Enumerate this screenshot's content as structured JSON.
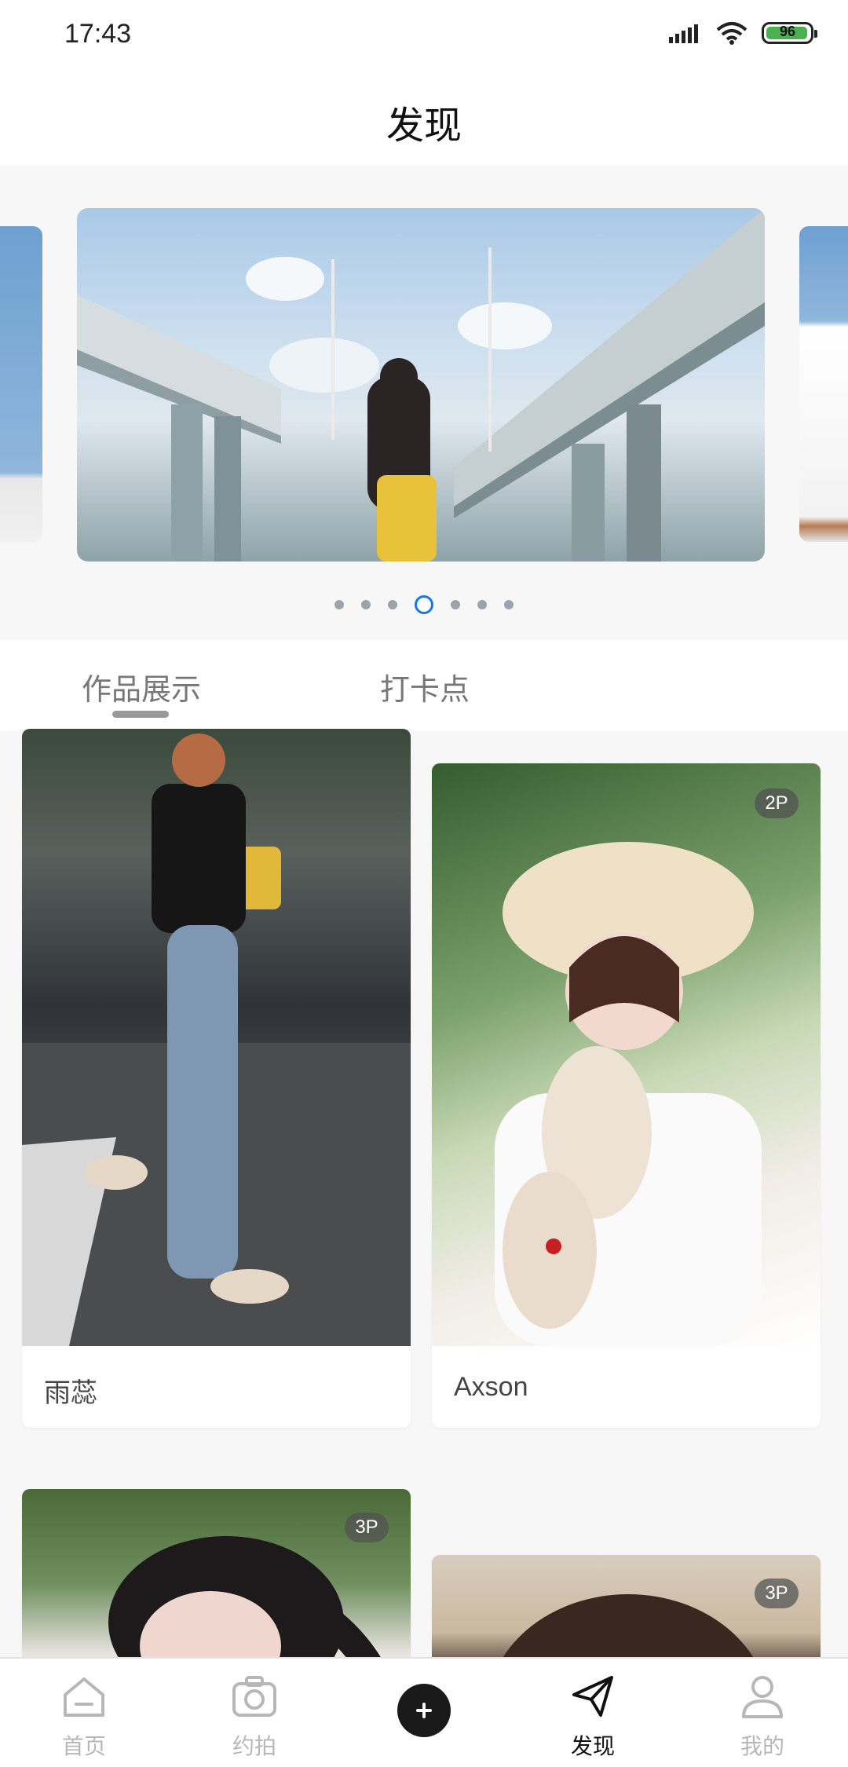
{
  "status": {
    "time": "17:43",
    "battery": "96"
  },
  "header": {
    "title": "发现"
  },
  "carousel": {
    "page_count": 7,
    "active_index": 3
  },
  "tabs": [
    {
      "label": "作品展示",
      "active": true
    },
    {
      "label": "打卡点",
      "active": false
    }
  ],
  "cards": [
    {
      "name": "雨蕊",
      "badge": ""
    },
    {
      "name": "Axson",
      "badge": "2P"
    },
    {
      "name": "",
      "badge": "3P"
    },
    {
      "name": "",
      "badge": "3P"
    }
  ],
  "nav": {
    "items": [
      {
        "label": "首页",
        "icon": "home-icon"
      },
      {
        "label": "约拍",
        "icon": "camera-icon"
      },
      {
        "label": "",
        "icon": "plus-icon"
      },
      {
        "label": "发现",
        "icon": "paper-plane-icon",
        "active": true
      },
      {
        "label": "我的",
        "icon": "person-icon"
      }
    ]
  },
  "colors": {
    "accent": "#1877e8",
    "battery": "#4caf50"
  }
}
